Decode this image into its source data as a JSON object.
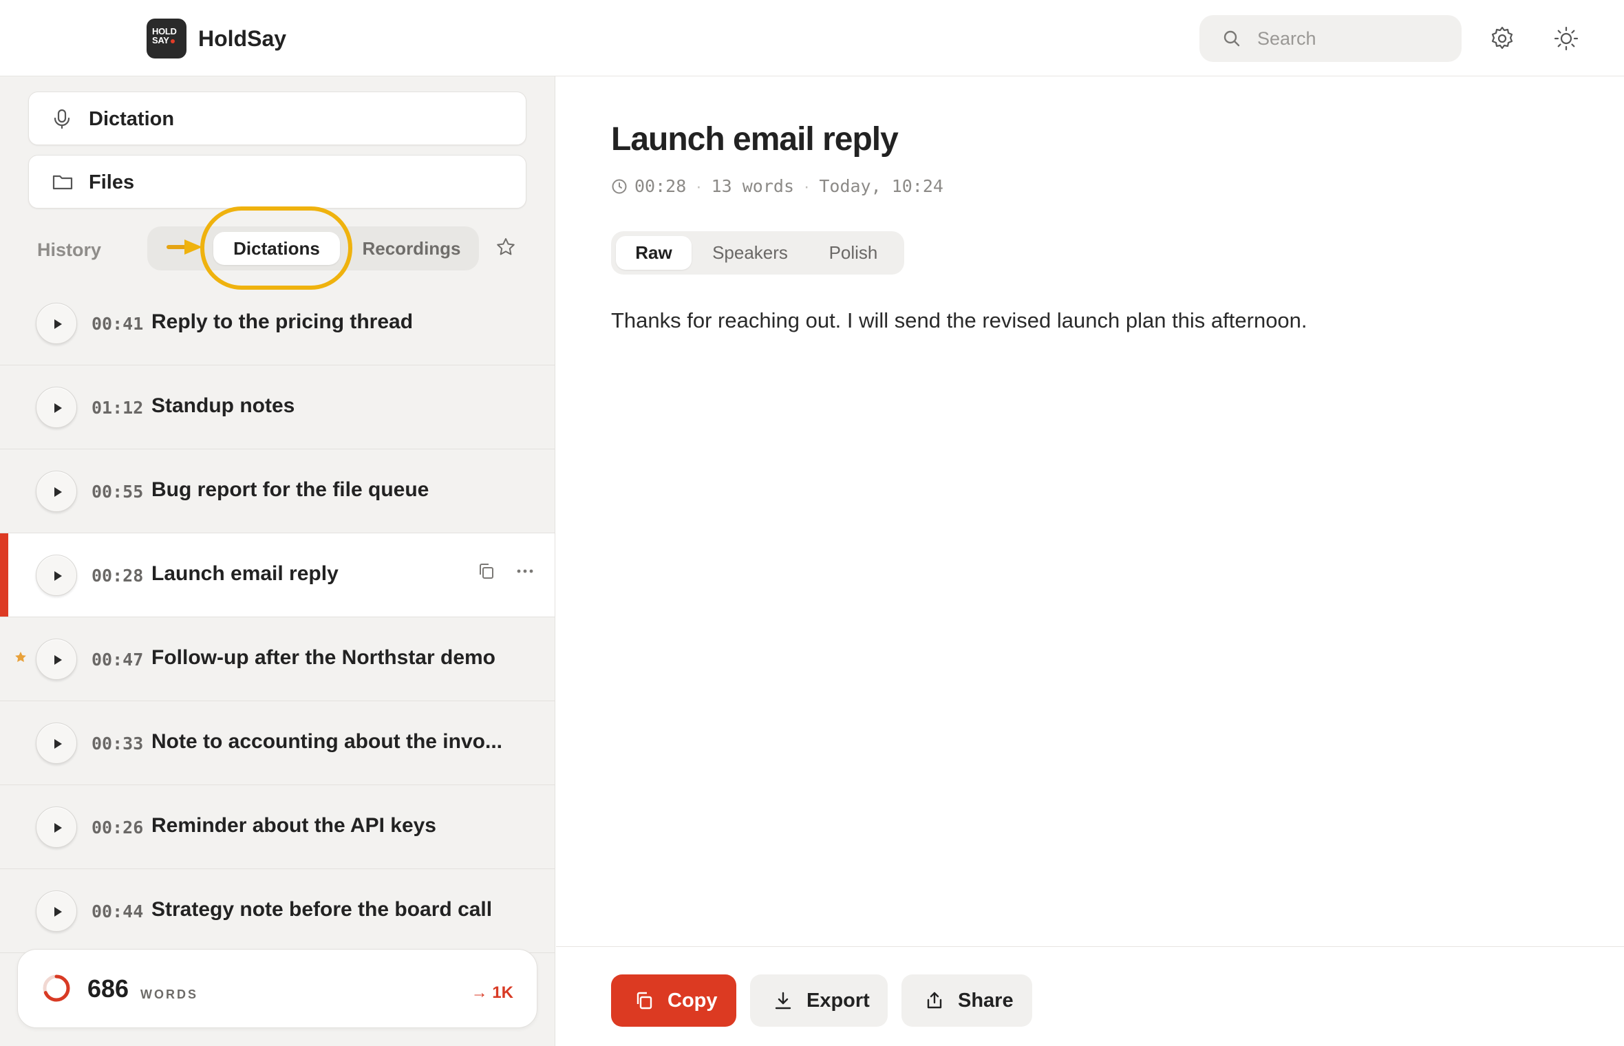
{
  "app": {
    "name": "HoldSay",
    "logo_text": [
      "HOLD",
      "SAY"
    ]
  },
  "header": {
    "search_placeholder": "Search",
    "icons": [
      "search-icon",
      "gear-icon",
      "sun-icon"
    ]
  },
  "sidebar": {
    "nav": [
      {
        "label": "Dictation",
        "icon": "microphone-icon"
      },
      {
        "label": "Files",
        "icon": "folder-icon"
      }
    ],
    "history_label": "History",
    "filters": {
      "selected": "Dictations",
      "options": [
        "Dictations",
        "Recordings"
      ]
    },
    "items": [
      {
        "duration": "00:41",
        "title": "Reply to the pricing thread",
        "starred": false,
        "selected": false
      },
      {
        "duration": "01:12",
        "title": "Standup notes",
        "starred": false,
        "selected": false
      },
      {
        "duration": "00:55",
        "title": "Bug report for the file queue",
        "starred": false,
        "selected": false
      },
      {
        "duration": "00:28",
        "title": "Launch email reply",
        "starred": false,
        "selected": true
      },
      {
        "duration": "00:47",
        "title": "Follow-up after the Northstar demo",
        "starred": true,
        "selected": false
      },
      {
        "duration": "00:33",
        "title": "Note to accounting about the invo...",
        "starred": false,
        "selected": false
      },
      {
        "duration": "00:26",
        "title": "Reminder about the API keys",
        "starred": false,
        "selected": false
      },
      {
        "duration": "00:44",
        "title": "Strategy note before the board call",
        "starred": false,
        "selected": false
      }
    ],
    "footer": {
      "word_count": "686",
      "unit": "WORDS",
      "goal": "→ 1K",
      "progress": 0.686
    }
  },
  "main": {
    "title": "Launch email reply",
    "meta": {
      "duration": "00:28",
      "words": "13 words",
      "when": "Today, 10:24"
    },
    "tabs": [
      {
        "label": "Raw",
        "active": true
      },
      {
        "label": "Speakers",
        "active": false
      },
      {
        "label": "Polish",
        "active": false
      }
    ],
    "text": "Thanks for reaching out. I will send the revised launch plan this afternoon.",
    "actions": {
      "copy": "Copy",
      "export": "Export",
      "share": "Share"
    }
  },
  "colors": {
    "accent": "#dc3a22",
    "highlight": "#efb20e",
    "star": "#e8a13a",
    "sidebar_bg": "#f3f2f0"
  }
}
